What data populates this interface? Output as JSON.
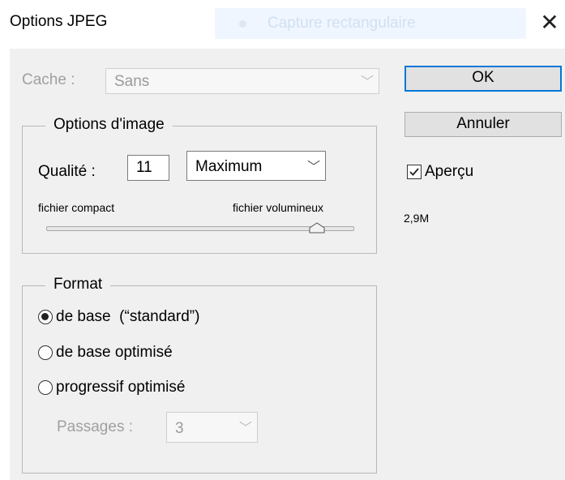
{
  "window": {
    "title": "Options JPEG",
    "close_glyph": "✕"
  },
  "background_tab": {
    "label": "Capture rectangulaire"
  },
  "cache": {
    "label": "Cache :",
    "value": "Sans"
  },
  "buttons": {
    "ok": "OK",
    "cancel": "Annuler"
  },
  "preview": {
    "label": "Aperçu",
    "checked": true,
    "size": "2,9M"
  },
  "image_options": {
    "legend": "Options d'image",
    "quality_label": "Qualité :",
    "quality_value": "11",
    "quality_preset": "Maximum",
    "slider_min_label": "fichier compact",
    "slider_max_label": "fichier volumineux",
    "slider_fraction": 0.88
  },
  "format": {
    "legend": "Format",
    "options": [
      "de base  (“standard”)",
      "de base optimisé",
      "progressif optimisé"
    ],
    "selected_index": 0,
    "passes_label": "Passages :",
    "passes_value": "3"
  },
  "icons": {
    "chevron": "chevron-down-icon",
    "close": "close-icon",
    "check": "check-icon"
  }
}
